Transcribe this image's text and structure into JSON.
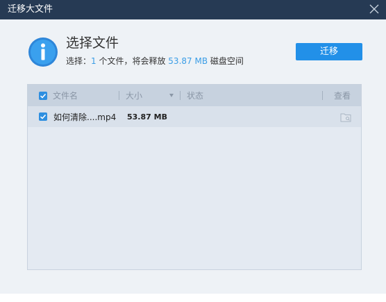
{
  "window": {
    "title": "迁移大文件"
  },
  "header": {
    "headline": "选择文件",
    "summary_prefix": "选择：",
    "selected_count": "1",
    "summary_middle": " 个文件，将会释放 ",
    "size_value": "53.87 MB",
    "summary_suffix": " 磁盘空间",
    "migrate_label": "迁移"
  },
  "table": {
    "columns": {
      "name": "文件名",
      "size": "大小",
      "status": "状态",
      "view": "查看"
    },
    "rows": [
      {
        "name": "如何清除....mp4",
        "size": "53.87 MB",
        "status": "",
        "checked": true
      }
    ]
  },
  "colors": {
    "titlebar": "#263a54",
    "accent": "#2290e8",
    "highlight_text": "#3a9de6"
  },
  "icons": [
    "info-icon",
    "close-icon",
    "checkbox-check-icon",
    "sort-down-icon",
    "folder-icon"
  ]
}
